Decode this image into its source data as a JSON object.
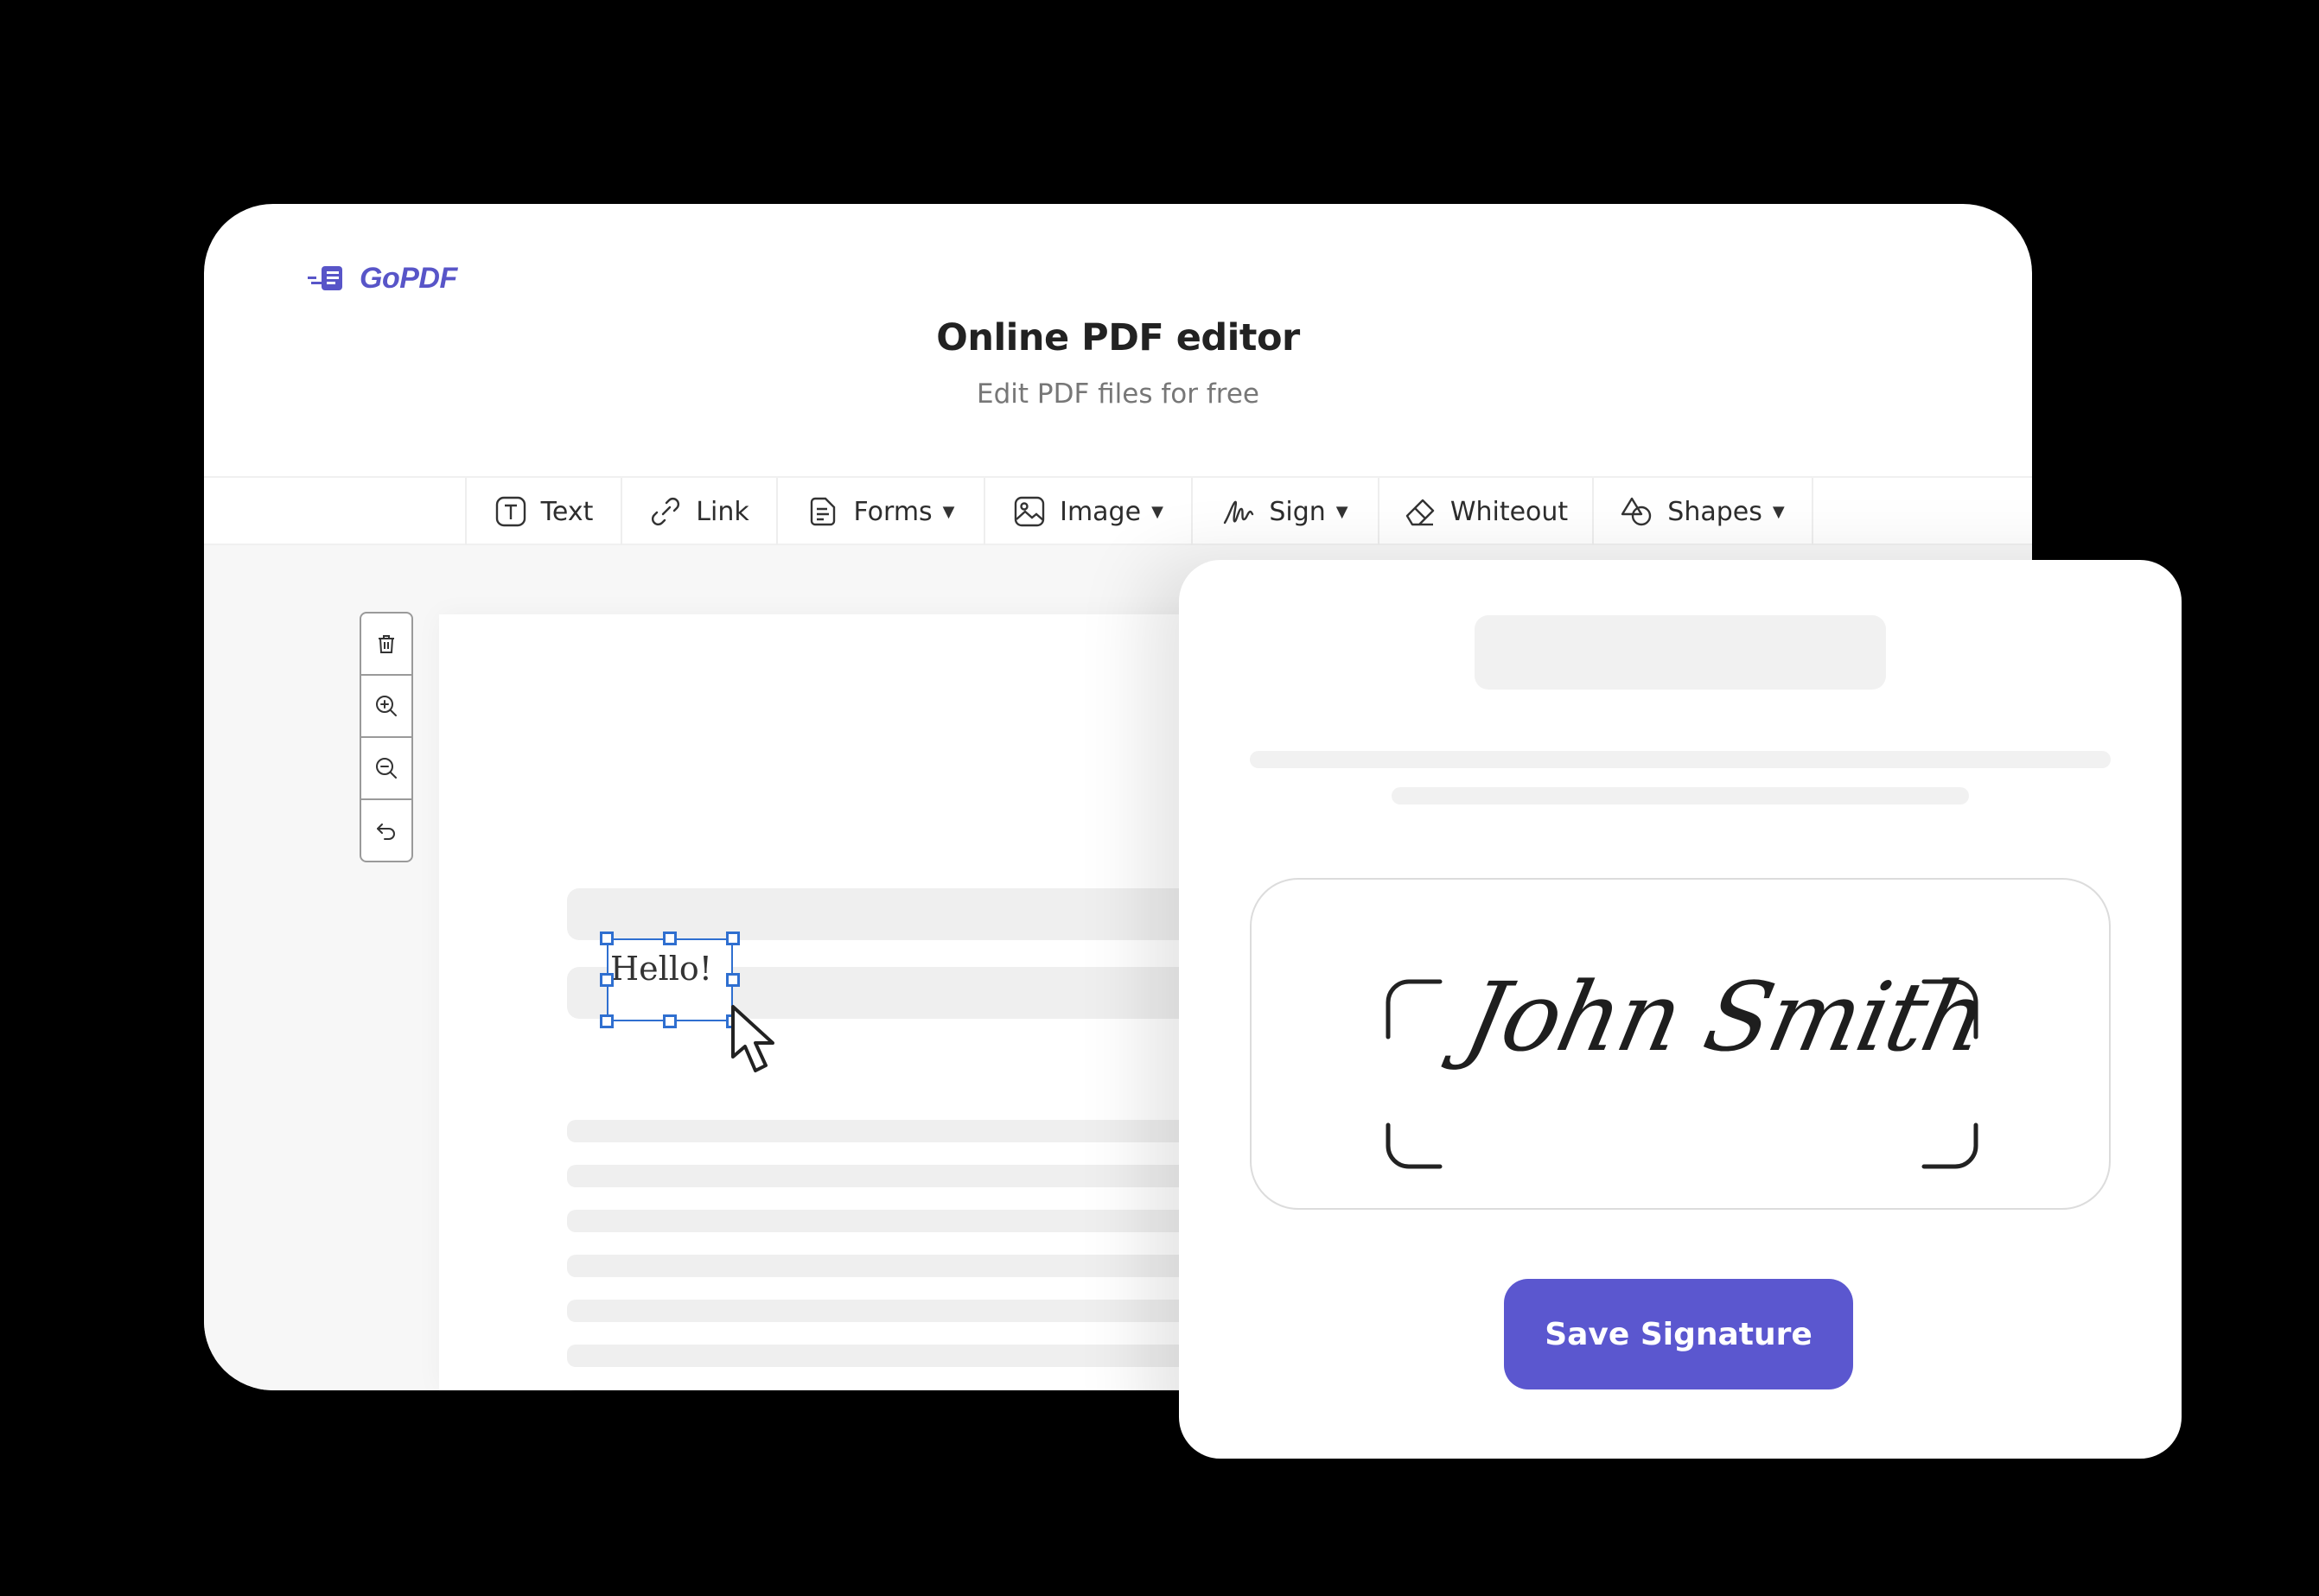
{
  "brand": {
    "name": "GoPDF",
    "color": "#5855c8"
  },
  "header": {
    "title": "Online PDF editor",
    "subtitle": "Edit PDF files for free"
  },
  "toolbar": {
    "items": [
      {
        "label": "Text",
        "icon": "text-box-icon",
        "dropdown": false
      },
      {
        "label": "Link",
        "icon": "link-icon",
        "dropdown": false
      },
      {
        "label": "Forms",
        "icon": "form-document-icon",
        "dropdown": true
      },
      {
        "label": "Image",
        "icon": "image-icon",
        "dropdown": true
      },
      {
        "label": "Sign",
        "icon": "signature-icon",
        "dropdown": true
      },
      {
        "label": "Whiteout",
        "icon": "eraser-icon",
        "dropdown": false
      },
      {
        "label": "Shapes",
        "icon": "shapes-icon",
        "dropdown": true
      }
    ]
  },
  "side_tools": [
    {
      "icon": "trash-icon"
    },
    {
      "icon": "zoom-in-icon"
    },
    {
      "icon": "zoom-out-icon"
    },
    {
      "icon": "undo-icon"
    }
  ],
  "document": {
    "text_element": "Hello!"
  },
  "signature_dialog": {
    "signature_text": "John Smith",
    "save_label": "Save Signature"
  },
  "colors": {
    "accent": "#5b57cf",
    "selection": "#2f6fd0",
    "background": "#000000"
  }
}
